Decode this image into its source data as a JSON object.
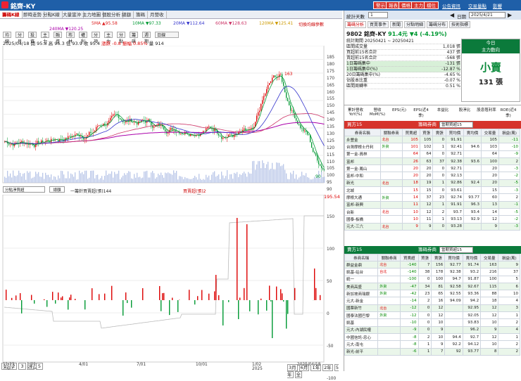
{
  "app": {
    "title": "銘齊-KY",
    "top_buttons": [
      "警示",
      "報表",
      "價格",
      "主力",
      "檔位"
    ],
    "top_links": [
      "公告資訊",
      "交易量點",
      "影響"
    ]
  },
  "tabs": [
    "籌碼K線",
    "即時走勢",
    "分點K線",
    "大量當沖",
    "主力地圖",
    "個股分析",
    "總額",
    "籌碼",
    "月營收"
  ],
  "toolbar": [
    "均線",
    "分貝",
    "投資",
    "主力",
    "融資",
    "布林",
    "權利",
    "分項",
    "主力",
    "分點",
    "籌碼",
    "週期",
    "日線"
  ],
  "info": {
    "date": "2025/04/18",
    "open": "開 95.8",
    "high": "高 96.3",
    "low": "低 93.9",
    "close": "收 95.4",
    "chg_label": "漲跌 -0.8",
    "amp_label": "振幅 0.85%",
    "vol": "量 914"
  },
  "ma": {
    "ma5": "5MA ▲95.58",
    "ma10": "10MA ▼97.33",
    "ma20": "20MA ▼112.64",
    "ma60": "60MA ▼128.63",
    "ma240": "240MA ▼120.25",
    "ma120": "120MA ▼125.41",
    "note": "切換均線參數"
  },
  "yaxis1": [
    "185",
    "180",
    "175",
    "170",
    "165",
    "160",
    "155",
    "150",
    "145",
    "140",
    "135",
    "130",
    "125",
    "120",
    "115",
    "110",
    "105",
    "100",
    "95",
    "90"
  ],
  "peak_label": "163",
  "last_label": "90",
  "chart2": {
    "title": "分點淨買超",
    "btn": "總額",
    "legend1": "一籌針買賣超(張)144",
    "legend2": "買賣超(張)2",
    "legend3": "買張 4 賣張 2",
    "right_val": "195.54"
  },
  "yaxis2": [
    "150",
    "100",
    "50",
    "0",
    "-50",
    "-100"
  ],
  "xaxis": [
    "11/23\n2023",
    "1/02\n2024",
    "4/01",
    "7/01",
    "10/01",
    "1/02\n2025",
    "2025/04/18"
  ],
  "controls": [
    "3月",
    "6月",
    "1年",
    "2年",
    "5年",
    "全"
  ],
  "pager": [
    "1",
    "2",
    "3",
    "4",
    "5"
  ],
  "right": {
    "label": "統計天數",
    "days": "1",
    "date": "2025/4/21",
    "date_label": "日期",
    "tabs": [
      "籌碼分析",
      "買賣事件",
      "新聞",
      "分點明細",
      "籌碼分布",
      "技術指標"
    ],
    "stock": "9802 銘齊-KY",
    "price": "91.4元",
    "change": "▼4 (-4.19%)",
    "stats": [
      [
        "統計期間 20250421 ~ 20250421",
        ""
      ],
      [
        "區間成交量",
        "1,018 張"
      ],
      [
        "買超前15名合計",
        "437 張"
      ],
      [
        "賣超前15名合計",
        "-568 張"
      ],
      [
        "1日籌碼集中",
        "-131 張"
      ],
      [
        "1日籌碼集中(%)",
        "-12.87 %"
      ],
      [
        "20日籌碼集中(%)",
        "-4.65 %"
      ],
      [
        "佔股本比重",
        "-0.07 %"
      ],
      [
        "區間周轉率",
        "0.51 %"
      ]
    ],
    "today_head": "今日\n主力動向",
    "today_val": "小賣",
    "today_sub": "131 張",
    "fin_labels": [
      "累計營收YoY(%)",
      "營收MoM(%)",
      "EPS(元)",
      "EPS(近4季)",
      "本益比",
      "股淨比",
      "股息殖利率",
      "ROE(近4季)"
    ],
    "fin_values": [
      "37.92",
      "24.77",
      "3.07",
      "5.43",
      "9.6",
      "1.33",
      "5.24",
      "9.8"
    ],
    "buy_head": "買方15",
    "sell_head": "賣方15",
    "filter": "籌碼券商",
    "filter_val": "當期買超15",
    "cols": [
      "券商名稱",
      "關聯券商",
      "買賣超",
      "買張",
      "賣張",
      "買均價",
      "賣均價",
      "交易量",
      "損益(萬)"
    ],
    "buy_rows": [
      [
        "永豐金",
        "北台",
        "105",
        "105",
        "0",
        "91.91",
        "",
        "105",
        "-11"
      ],
      [
        "台灣摩根士丹利",
        "外資",
        "101",
        "102",
        "1",
        "92.41",
        "94.6",
        "103",
        "-10"
      ],
      [
        "第一金-員林",
        "",
        "64",
        "64",
        "0",
        "92.71",
        "",
        "64",
        "-9"
      ],
      [
        "富邦",
        "",
        "26",
        "63",
        "37",
        "92.38",
        "93.6",
        "100",
        "2"
      ],
      [
        "第一金-鳳山",
        "",
        "20",
        "20",
        "0",
        "92.71",
        "",
        "20",
        "-3"
      ],
      [
        "富邦-中和",
        "",
        "20",
        "20",
        "0",
        "92.13",
        "",
        "20",
        "-2"
      ],
      [
        "新光",
        "北台",
        "18",
        "19",
        "1",
        "92.86",
        "92.4",
        "20",
        "-5"
      ],
      [
        "北城",
        "",
        "15",
        "15",
        "0",
        "93.61",
        "",
        "15",
        "-3"
      ],
      [
        "摩根大通",
        "外資",
        "14",
        "37",
        "23",
        "92.74",
        "93.77",
        "60",
        "2"
      ],
      [
        "富邦-新興",
        "",
        "11",
        "12",
        "1",
        "91.91",
        "96.3",
        "13",
        "-1"
      ],
      [
        "台新",
        "北台",
        "10",
        "12",
        "2",
        "93.7",
        "93.4",
        "14",
        "-5"
      ],
      [
        "國泰-板橋",
        "",
        "10",
        "11",
        "1",
        "93.13",
        "92.9",
        "12",
        "-2"
      ],
      [
        "元大-三六",
        "北台",
        "9",
        "9",
        "0",
        "93.28",
        "",
        "9",
        "-3"
      ]
    ],
    "sell_rows": [
      [
        "群益金鼎",
        "北台",
        "-140",
        "7",
        "156",
        "92.77",
        "91.74",
        "163",
        "9"
      ],
      [
        "凱基-站台",
        "台北",
        "-140",
        "38",
        "178",
        "92.38",
        "93.2",
        "216",
        "37"
      ],
      [
        "統一",
        "",
        "-100",
        "0",
        "100",
        "94.7",
        "91.87",
        "100",
        "5"
      ],
      [
        "美商高盛",
        "外資",
        "-47",
        "34",
        "81",
        "92.58",
        "92.67",
        "115",
        "6"
      ],
      [
        "新加坡商瑞銀",
        "外資",
        "-42",
        "23",
        "65",
        "92.55",
        "93.36",
        "88",
        "10"
      ],
      [
        "元大-新金",
        "",
        "-14",
        "2",
        "16",
        "94.09",
        "94.2",
        "18",
        "4"
      ],
      [
        "國票新竹",
        "北台",
        "-12",
        "0",
        "12",
        "",
        "92.95",
        "12",
        "3"
      ],
      [
        "國泰法國巴黎",
        "外資",
        "-12",
        "0",
        "12",
        "",
        "92.05",
        "12",
        "1"
      ],
      [
        "凱基",
        "",
        "-10",
        "0",
        "10",
        "",
        "93.83",
        "10",
        "2"
      ],
      [
        "元大-內湖民權",
        "",
        "-9",
        "0",
        "9",
        "",
        "96.2",
        "9",
        "4"
      ],
      [
        "中國信託-忠心",
        "",
        "-8",
        "2",
        "10",
        "94.4",
        "92.7",
        "12",
        "1"
      ],
      [
        "元大-南屯",
        "",
        "-8",
        "1",
        "9",
        "92.2",
        "94.12",
        "10",
        "2"
      ],
      [
        "新光-前平",
        "",
        "-6",
        "1",
        "7",
        "92",
        "93.77",
        "8",
        "2"
      ]
    ]
  },
  "chart_data": [
    {
      "type": "line",
      "title": "",
      "x": [
        "2023-11",
        "2024-01",
        "2024-04",
        "2024-07",
        "2024-10",
        "2025-01",
        "2025-04"
      ],
      "series": [
        {
          "name": "5MA",
          "values": [
            115,
            118,
            132,
            135,
            128,
            140,
            96
          ]
        },
        {
          "name": "20MA",
          "values": [
            118,
            120,
            128,
            133,
            130,
            150,
            113
          ]
        },
        {
          "name": "60MA",
          "values": [
            120,
            121,
            125,
            130,
            131,
            142,
            129
          ]
        },
        {
          "name": "240MA",
          "values": [
            119,
            120,
            122,
            124,
            125,
            126,
            120
          ]
        }
      ],
      "ylim": [
        90,
        185
      ]
    },
    {
      "type": "bar",
      "title": "",
      "x": [
        "2023-11",
        "2024-01",
        "2024-04",
        "2024-07",
        "2024-10",
        "2025-01",
        "2025-04"
      ],
      "values": [
        10,
        -20,
        15,
        30,
        20,
        130,
        40
      ],
      "ylim": [
        -100,
        150
      ]
    }
  ]
}
